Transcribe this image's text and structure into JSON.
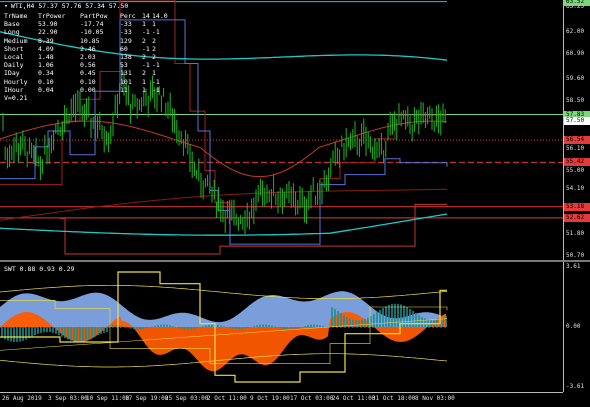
{
  "chart_title": "WTI,H4  57.37 57.76 57.34 57.50",
  "indicator_title": "SWT 0.88 0.93 0.29",
  "stats": {
    "headers": [
      "TrName",
      "TrPower",
      "PartPow",
      "Perc",
      "14",
      "14.0"
    ],
    "rows": [
      [
        "Base",
        "53.90",
        "-17.74",
        "-33",
        "1",
        "1"
      ],
      [
        "Long",
        "22.90",
        "-10.05",
        "-33",
        "-1",
        "-1"
      ],
      [
        "Medium",
        "8.39",
        "10.85",
        "129",
        "2",
        "2"
      ],
      [
        "Short",
        "4.09",
        "2.46",
        "60",
        "-1",
        "2"
      ],
      [
        "Local",
        "1.48",
        "2.03",
        "138",
        "2",
        "2"
      ],
      [
        "Daily",
        "1.06",
        "0.56",
        "53",
        "-1",
        "-1"
      ],
      [
        "IDay",
        "0.34",
        "0.45",
        "131",
        "2",
        "1"
      ],
      [
        "Hourly",
        "0.10",
        "0.10",
        "101",
        "1",
        "-1"
      ],
      [
        "IHour",
        "0.04",
        "0.00",
        "11",
        "1",
        "-1"
      ]
    ],
    "v_line": "V=0.21"
  },
  "price_axis": [
    "63.25",
    "62.00",
    "60.90",
    "59.60",
    "58.50",
    "57.50",
    "56.10",
    "55.00",
    "54.10",
    "53.00",
    "51.80",
    "50.70"
  ],
  "price_tags": [
    {
      "label": "63.52",
      "color": "#7cd67c",
      "value": 63.52
    },
    {
      "label": "57.83",
      "color": "#7cd67c",
      "value": 57.83
    },
    {
      "label": "57.50",
      "color": "#ffffff",
      "value": 57.5
    },
    {
      "label": "56.54",
      "color": "#e33b3b",
      "value": 56.54
    },
    {
      "label": "55.42",
      "color": "#e33b3b",
      "value": 55.42
    },
    {
      "label": "53.18",
      "color": "#e33b3b",
      "value": 53.18
    },
    {
      "label": "52.62",
      "color": "#e33b3b",
      "value": 52.62
    }
  ],
  "indicator_axis": [
    "3.61",
    "0.00",
    "-3.61"
  ],
  "time_axis": [
    "26 Aug 2019",
    "3 Sep 03:00",
    "10 Sep 11:00",
    "17 Sep 19:00",
    "25 Sep 03:00",
    "2 Oct 11:00",
    "9 Oct 19:00",
    "17 Oct 03:00",
    "24 Oct 11:00",
    "31 Oct 18:00",
    "8 Nov 03:00"
  ],
  "colors": {
    "candles": "#1fb81f",
    "ma_cyan": "#1ec8c8",
    "ma_red": "#c0392b",
    "ma_blue": "#5a6fd6",
    "level_green": "#7cd67c",
    "level_red": "#e33b3b",
    "orange": "#ff5a00",
    "lightblue": "#7fa6e6",
    "yellow": "#f0e040",
    "teal": "#1a8f8f"
  }
}
